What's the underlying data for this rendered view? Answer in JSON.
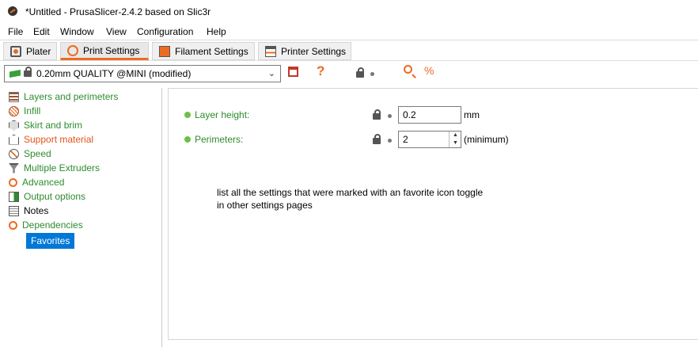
{
  "window": {
    "title": "*Untitled - PrusaSlicer-2.4.2 based on Slic3r"
  },
  "menu": [
    "File",
    "Edit",
    "Window",
    "View",
    "Configuration",
    "Help"
  ],
  "tabs": [
    {
      "label": "Plater",
      "icon": "plater-icon"
    },
    {
      "label": "Print Settings",
      "icon": "print-settings-icon"
    },
    {
      "label": "Filament Settings",
      "icon": "filament-icon"
    },
    {
      "label": "Printer Settings",
      "icon": "printer-icon"
    }
  ],
  "preset": {
    "value": "0.20mm QUALITY @MINI (modified)"
  },
  "toolbar": {
    "help_label": "?",
    "compare_glyph": "%"
  },
  "sidebar": {
    "items": [
      {
        "label": "Layers and perimeters",
        "color": "green",
        "icon": "layers-icon"
      },
      {
        "label": "Infill",
        "color": "green",
        "icon": "infill-icon"
      },
      {
        "label": "Skirt and brim",
        "color": "green",
        "icon": "skirt-icon"
      },
      {
        "label": "Support material",
        "color": "orange",
        "icon": "support-icon"
      },
      {
        "label": "Speed",
        "color": "green",
        "icon": "speed-icon"
      },
      {
        "label": "Multiple Extruders",
        "color": "green",
        "icon": "extruders-icon"
      },
      {
        "label": "Advanced",
        "color": "green",
        "icon": "advanced-icon"
      },
      {
        "label": "Output options",
        "color": "green",
        "icon": "output-icon"
      },
      {
        "label": "Notes",
        "color": "black",
        "icon": "notes-icon"
      },
      {
        "label": "Dependencies",
        "color": "green",
        "icon": "dependencies-icon"
      }
    ],
    "selected": "Favorites"
  },
  "options": [
    {
      "label": "Layer height:",
      "value": "0.2",
      "unit": "mm"
    },
    {
      "label": "Perimeters:",
      "value": "2",
      "unit": "(minimum)"
    }
  ],
  "note": {
    "line1": "list all the settings that were marked with an favorite icon toggle",
    "line2": "in other settings pages"
  },
  "colors": {
    "accent": "#ed6b21",
    "green": "#2e8b2e",
    "orange": "#e0561b",
    "selection": "#0078d7"
  }
}
